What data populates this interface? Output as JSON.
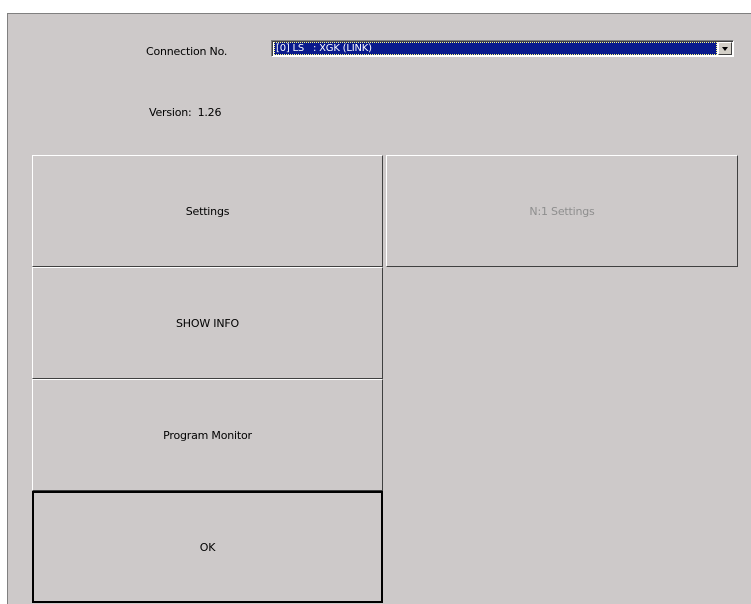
{
  "connection": {
    "label": "Connection No.",
    "selected_value": "[0] LS   : XGK (LINK)"
  },
  "version": {
    "label": "Version:",
    "value": "1.26"
  },
  "buttons": {
    "settings": "Settings",
    "n1_settings": "N:1 Settings",
    "show_info": "SHOW INFO",
    "program_monitor": "Program Monitor",
    "ok": "OK"
  },
  "icons": {
    "combo_arrow": "chevron-down-icon"
  }
}
